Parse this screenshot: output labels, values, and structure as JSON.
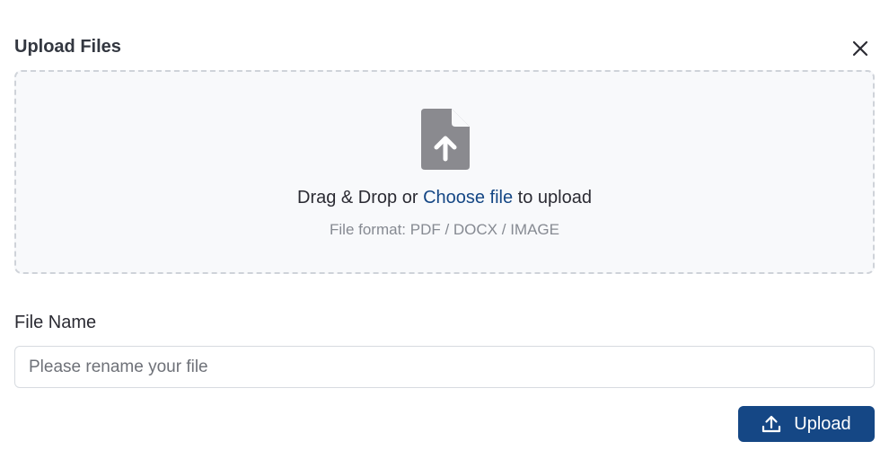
{
  "modal": {
    "title": "Upload Files",
    "close_icon": "close-icon"
  },
  "dropzone": {
    "icon": "file-upload-icon",
    "text_before": "Drag & Drop or ",
    "link_text": "Choose file",
    "text_after": " to upload",
    "format_hint": "File format: PDF / DOCX / IMAGE"
  },
  "file_name": {
    "label": "File Name",
    "value": "",
    "placeholder": "Please rename your file"
  },
  "actions": {
    "upload_label": "Upload",
    "upload_icon": "upload-icon"
  },
  "colors": {
    "accent": "#154785",
    "icon_gray": "#8a8a8f",
    "dropzone_bg": "#f8f9fb",
    "dropzone_border": "#cfd3d9"
  }
}
